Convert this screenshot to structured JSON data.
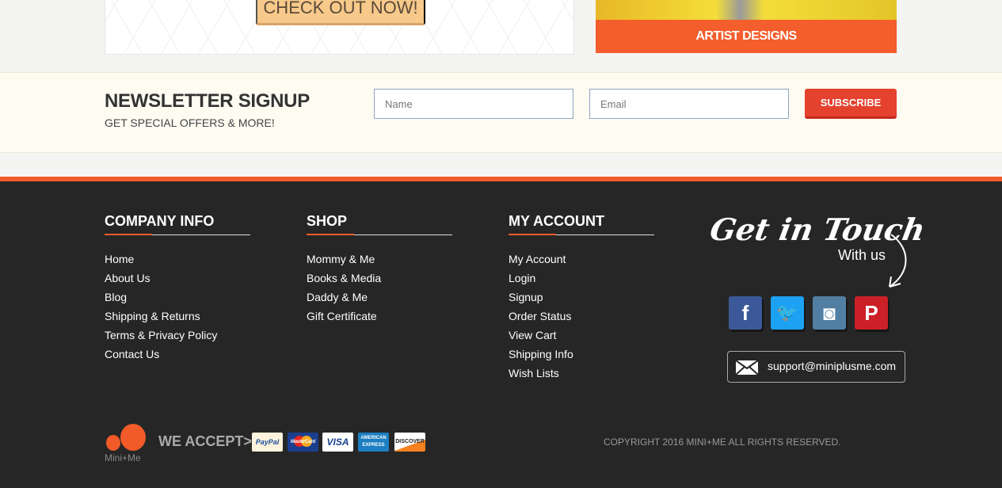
{
  "promo": {
    "checkout_label": "CHECK OUT NOW!",
    "artist_label": "ARTIST DESIGNS"
  },
  "newsletter": {
    "title": "NEWSLETTER SIGNUP",
    "subtitle": "GET SPECIAL OFFERS & MORE!",
    "name_placeholder": "Name",
    "email_placeholder": "Email",
    "subscribe_label": "SUBSCRIBE"
  },
  "footer": {
    "columns": [
      {
        "title": "COMPANY INFO",
        "links": [
          "Home",
          "About Us",
          "Blog",
          "Shipping & Returns",
          "Terms & Privacy Policy",
          "Contact Us"
        ]
      },
      {
        "title": "SHOP",
        "links": [
          "Mommy & Me",
          "Books & Media",
          "Daddy & Me",
          "Gift Certificate"
        ]
      },
      {
        "title": "MY ACCOUNT",
        "links": [
          "My Account",
          "Login",
          "Signup",
          "Order Status",
          "View Cart",
          "Shipping Info",
          "Wish Lists"
        ]
      }
    ],
    "get_in_touch": "Get in Touch",
    "with_us": "With us",
    "social": [
      {
        "name": "facebook",
        "glyph": "f",
        "color": "#3b5998"
      },
      {
        "name": "twitter",
        "glyph": "🐦",
        "color": "#1da1f2"
      },
      {
        "name": "instagram",
        "glyph": "◙",
        "color": "#517fa4"
      },
      {
        "name": "pinterest",
        "glyph": "P",
        "color": "#cb2027"
      }
    ],
    "email": "support@miniplusme.com",
    "logo_text": "Mini+Me",
    "we_accept": "WE ACCEPT>",
    "cards": [
      "PayPal",
      "MasterCard",
      "VISA",
      "AMERICAN EXPRESS",
      "DISCOVER"
    ],
    "copyright": "COPYRIGHT 2016 MINI+ME ALL RIGHTS RESERVED.",
    "accent": "#f15a29"
  }
}
